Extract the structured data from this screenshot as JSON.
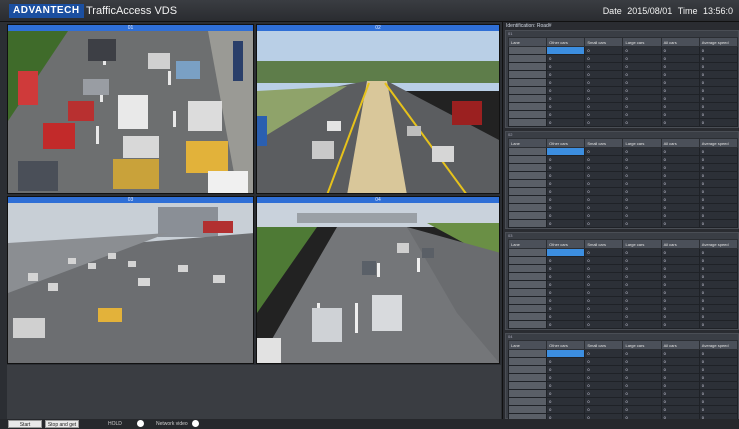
{
  "app": {
    "brand": "ADVANTECH",
    "title": "TrafficAccess VDS",
    "date_label": "Date",
    "date_value": "2015/08/01",
    "time_label": "Time",
    "time_value": "13:56:0"
  },
  "cameras": [
    {
      "label": "01"
    },
    {
      "label": "02"
    },
    {
      "label": "03"
    },
    {
      "label": "04"
    }
  ],
  "panel": {
    "title": "Identification: Road#",
    "columns": [
      "Lane",
      "Other cars",
      "Small cars",
      "Large cars",
      "All cars",
      "Average speed"
    ],
    "blocks": [
      {
        "tag": "01",
        "rows": [
          "",
          "",
          "",
          "",
          "",
          "",
          "",
          "",
          "",
          ""
        ]
      },
      {
        "tag": "02",
        "rows": [
          "",
          "",
          "",
          "",
          "",
          "",
          "",
          "",
          "",
          ""
        ]
      },
      {
        "tag": "03",
        "rows": [
          "",
          "",
          "",
          "",
          "",
          "",
          "",
          "",
          "",
          ""
        ]
      },
      {
        "tag": "04",
        "rows": [
          "",
          "",
          "",
          "",
          "",
          "",
          "",
          "",
          ""
        ]
      }
    ],
    "cell_value": "0"
  },
  "footer": {
    "start_label": "Start",
    "stop_label": "Stop and get count",
    "hold_label": "HOLD",
    "network_label": "Network video"
  },
  "colors": {
    "accent": "#2f6fd6",
    "highlight": "#3c8ee0",
    "brand": "#1b4fa0"
  }
}
